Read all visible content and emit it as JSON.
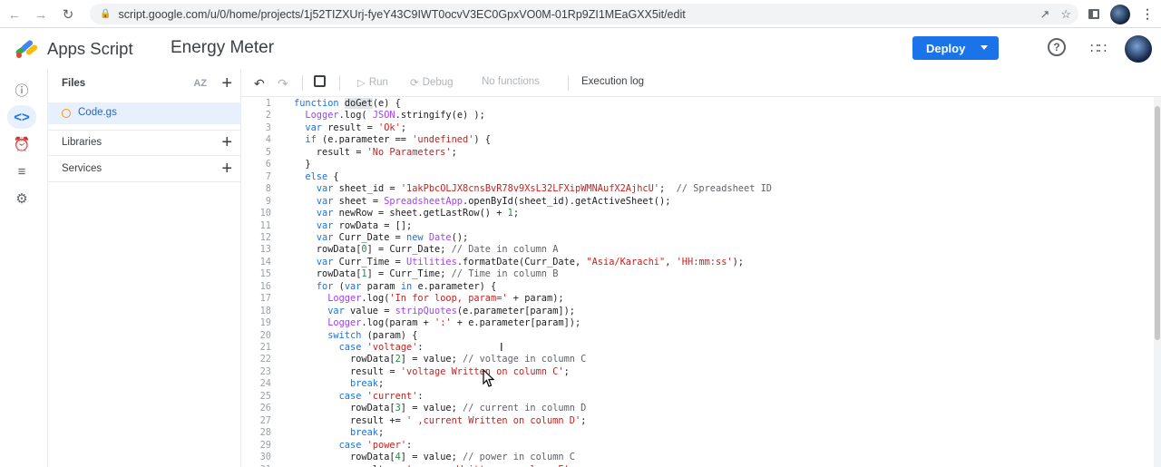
{
  "browser": {
    "url": "script.google.com/u/0/home/projects/1j52TIZXUrj-fyeY43C9IWT0ocvV3EC0GpxVO0M-01Rp9ZI1MEaGXX5it/edit",
    "back_icon": "back-arrow-icon",
    "forward_icon": "forward-arrow-icon",
    "reload_icon": "reload-icon"
  },
  "header": {
    "app_name": "Apps Script",
    "project_name": "Energy Meter",
    "deploy_label": "Deploy"
  },
  "files_panel": {
    "files_label": "Files",
    "sort_label": "AZ",
    "file_name": "Code.gs",
    "libraries_label": "Libraries",
    "services_label": "Services"
  },
  "toolbar": {
    "run_label": "Run",
    "debug_label": "Debug",
    "functions_label": "No functions",
    "execution_log_label": "Execution log"
  },
  "code_lines": [
    "function doGet(e) {",
    "  Logger.log( JSON.stringify(e) );",
    "  var result = 'Ok';",
    "  if (e.parameter == 'undefined') {",
    "    result = 'No Parameters';",
    "  }",
    "  else {",
    "    var sheet_id = '1akPbcOLJX8cnsBvR78v9XsL32LFXipWMNAufX2AjhcU';  // Spreadsheet ID",
    "    var sheet = SpreadsheetApp.openById(sheet_id).getActiveSheet();",
    "    var newRow = sheet.getLastRow() + 1;",
    "    var rowData = [];",
    "    var Curr_Date = new Date();",
    "    rowData[0] = Curr_Date; // Date in column A",
    "    var Curr_Time = Utilities.formatDate(Curr_Date, \"Asia/Karachi\", 'HH:mm:ss');",
    "    rowData[1] = Curr_Time; // Time in column B",
    "    for (var param in e.parameter) {",
    "      Logger.log('In for loop, param=' + param);",
    "      var value = stripQuotes(e.parameter[param]);",
    "      Logger.log(param + ':' + e.parameter[param]);",
    "      switch (param) {",
    "        case 'voltage':",
    "          rowData[2] = value; // voltage in column C",
    "          result = 'voltage Written on column C';",
    "          break;",
    "        case 'current':",
    "          rowData[3] = value; // current in column D",
    "          result += ' ,current Written on column D';",
    "          break;",
    "        case 'power':",
    "          rowData[4] = value; // power in column C",
    "          result += ' ,power Written on column E';"
  ]
}
